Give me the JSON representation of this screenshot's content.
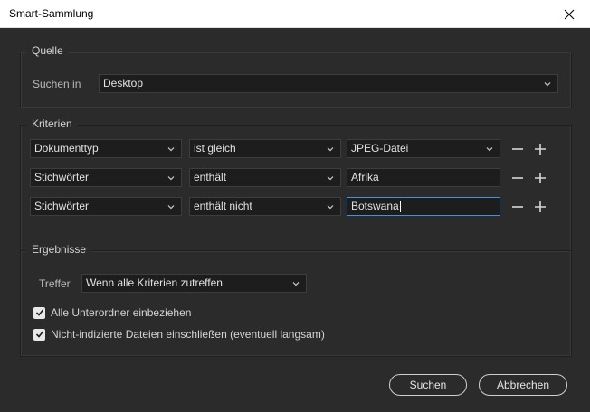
{
  "window": {
    "title": "Smart-Sammlung"
  },
  "quelle": {
    "legend": "Quelle",
    "suchen_in_label": "Suchen in",
    "suchen_in_value": "Desktop"
  },
  "kriterien": {
    "legend": "Kriterien",
    "rows": [
      {
        "field": "Dokumenttyp",
        "operator": "ist gleich",
        "value": "JPEG-Datei"
      },
      {
        "field": "Stichwörter",
        "operator": "enthält",
        "value": "Afrika"
      },
      {
        "field": "Stichwörter",
        "operator": "enthält nicht",
        "value": "Botswana"
      }
    ]
  },
  "ergebnisse": {
    "legend": "Ergebnisse",
    "treffer_label": "Treffer",
    "treffer_value": "Wenn alle Kriterien zutreffen",
    "checkbox1": "Alle Unterordner einbeziehen",
    "checkbox2": "Nicht-indizierte Dateien einschließen (eventuell langsam)"
  },
  "buttons": {
    "search": "Suchen",
    "cancel": "Abbrechen"
  },
  "icons": {
    "close": "close-icon",
    "chevron": "chevron-down-icon",
    "minus": "minus-icon",
    "plus": "plus-icon",
    "check": "checkmark-icon"
  },
  "colors": {
    "background": "#2b2b2b",
    "field": "#1d1d1d",
    "focus": "#4a90d9"
  }
}
